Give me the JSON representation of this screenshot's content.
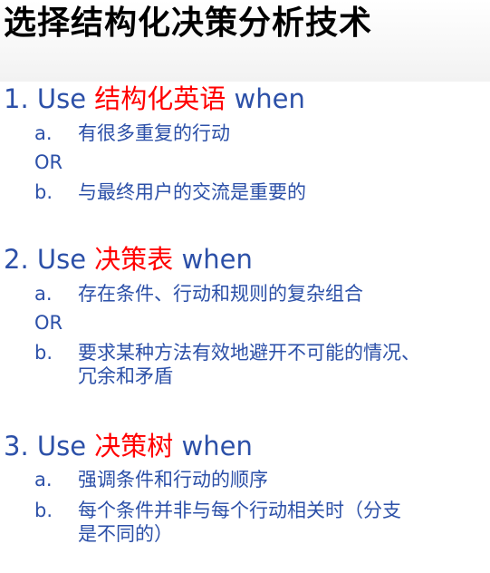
{
  "title": "选择结构化决策分析技术",
  "sections": [
    {
      "number": "1.",
      "use": "Use",
      "technique": "结构化英语",
      "when": "when",
      "items": [
        {
          "marker": "a.",
          "text": "有很多重复的行动"
        },
        {
          "marker": "b.",
          "text": "与最终用户的交流是重要的"
        }
      ],
      "or": "OR"
    },
    {
      "number": "2.",
      "use": "Use",
      "technique": "决策表",
      "when": "when",
      "items": [
        {
          "marker": "a.",
          "text": "存在条件、行动和规则的复杂组合"
        },
        {
          "marker": "b.",
          "text": "要求某种方法有效地避开不可能的情况、",
          "text_cont": "冗余和矛盾"
        }
      ],
      "or": "OR"
    },
    {
      "number": "3.",
      "use": "Use",
      "technique": "决策树",
      "when": "when",
      "items": [
        {
          "marker": "a.",
          "text": "强调条件和行动的顺序"
        },
        {
          "marker": "b.",
          "text": "每个条件并非与每个行动相关时（分支",
          "text_cont": "是不同的）"
        }
      ]
    }
  ]
}
